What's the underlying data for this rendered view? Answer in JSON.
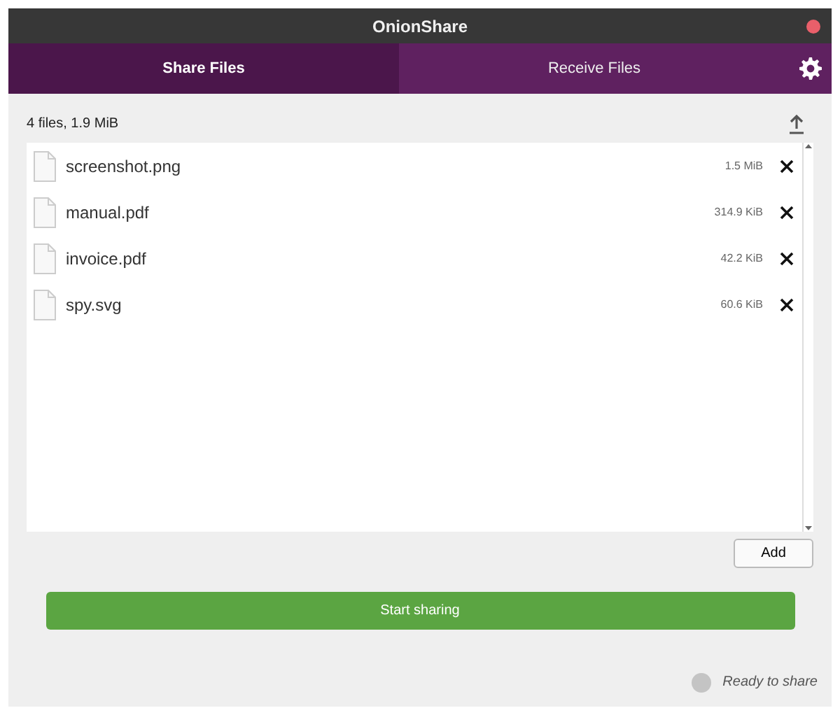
{
  "window": {
    "title": "OnionShare"
  },
  "tabs": [
    {
      "label": "Share Files",
      "selected": true
    },
    {
      "label": "Receive Files",
      "selected": false
    }
  ],
  "summary": "4 files, 1.9 MiB",
  "files": [
    {
      "name": "screenshot.png",
      "size": "1.5 MiB"
    },
    {
      "name": "manual.pdf",
      "size": "314.9 KiB"
    },
    {
      "name": "invoice.pdf",
      "size": "42.2 KiB"
    },
    {
      "name": "spy.svg",
      "size": "60.6 KiB"
    }
  ],
  "add_button": "Add",
  "start_button": "Start sharing",
  "status": "Ready to share"
}
